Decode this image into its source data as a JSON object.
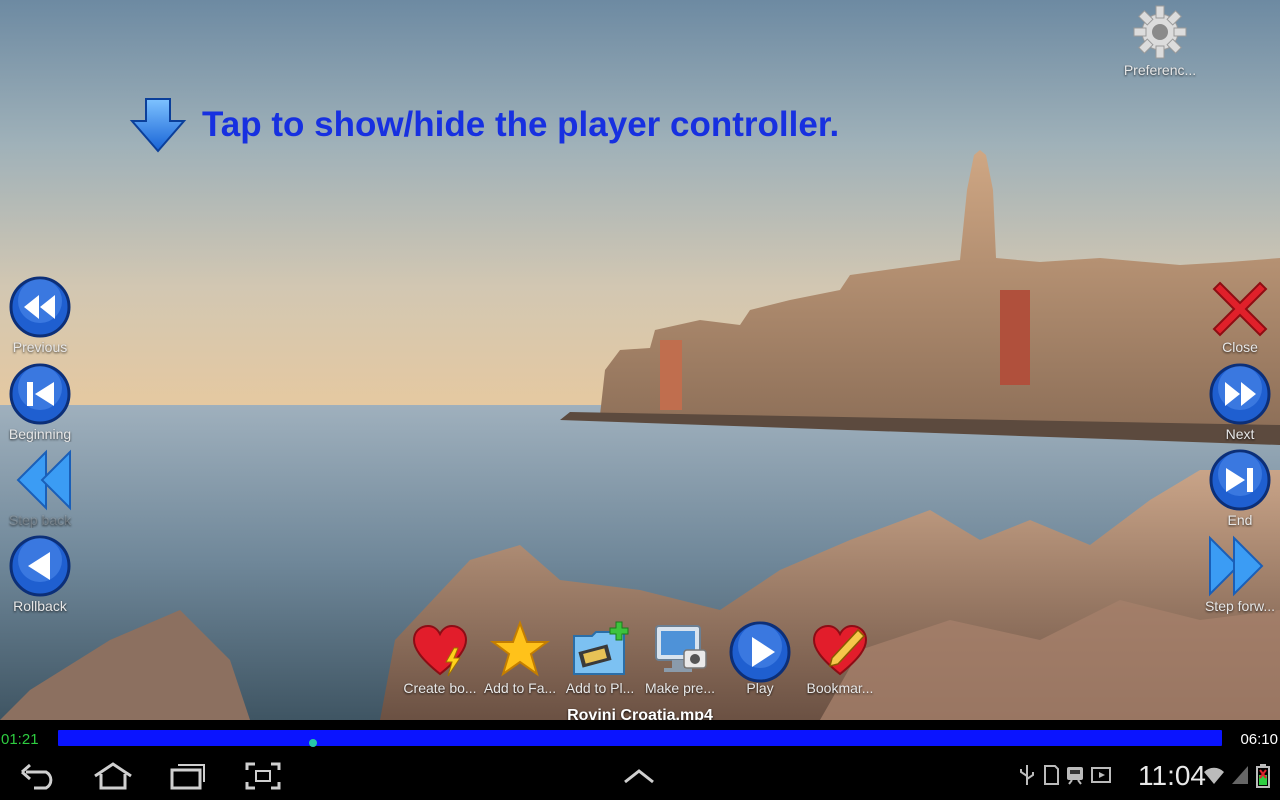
{
  "hint": {
    "text": "Tap to show/hide the player controller.",
    "icon": "down-arrow-icon"
  },
  "top_right": {
    "preferences_label": "Preferenc..."
  },
  "left_controls": [
    {
      "name": "previous",
      "label": "Previous"
    },
    {
      "name": "beginning",
      "label": "Beginning"
    },
    {
      "name": "step-back",
      "label": "Step back"
    },
    {
      "name": "rollback",
      "label": "Rollback"
    }
  ],
  "right_controls": [
    {
      "name": "close",
      "label": "Close"
    },
    {
      "name": "next",
      "label": "Next"
    },
    {
      "name": "end",
      "label": "End"
    },
    {
      "name": "step-forward",
      "label": "Step forw..."
    }
  ],
  "bottom_controls": [
    {
      "name": "create-bookmark",
      "label": "Create bo...",
      "icon": "heart-lightning-icon"
    },
    {
      "name": "add-to-favorites",
      "label": "Add to Fa...",
      "icon": "star-icon"
    },
    {
      "name": "add-to-playlist",
      "label": "Add to Pl...",
      "icon": "folder-film-plus-icon"
    },
    {
      "name": "make-preview",
      "label": "Make pre...",
      "icon": "monitor-camera-icon"
    },
    {
      "name": "play",
      "label": "Play",
      "icon": "play-icon"
    },
    {
      "name": "bookmarks",
      "label": "Bookmar...",
      "icon": "heart-pencil-icon"
    }
  ],
  "player": {
    "filename": "Rovinj Croatia.mp4",
    "elapsed": "01:21",
    "total": "06:10",
    "progress_fraction": 0.219
  },
  "status_bar": {
    "time": "11:04"
  },
  "colors": {
    "hint_text": "#1730e0",
    "progress": "#0a14ff",
    "elapsed_time": "#2ecc40",
    "total_time": "#ffffff",
    "close_red": "#e0202a"
  }
}
